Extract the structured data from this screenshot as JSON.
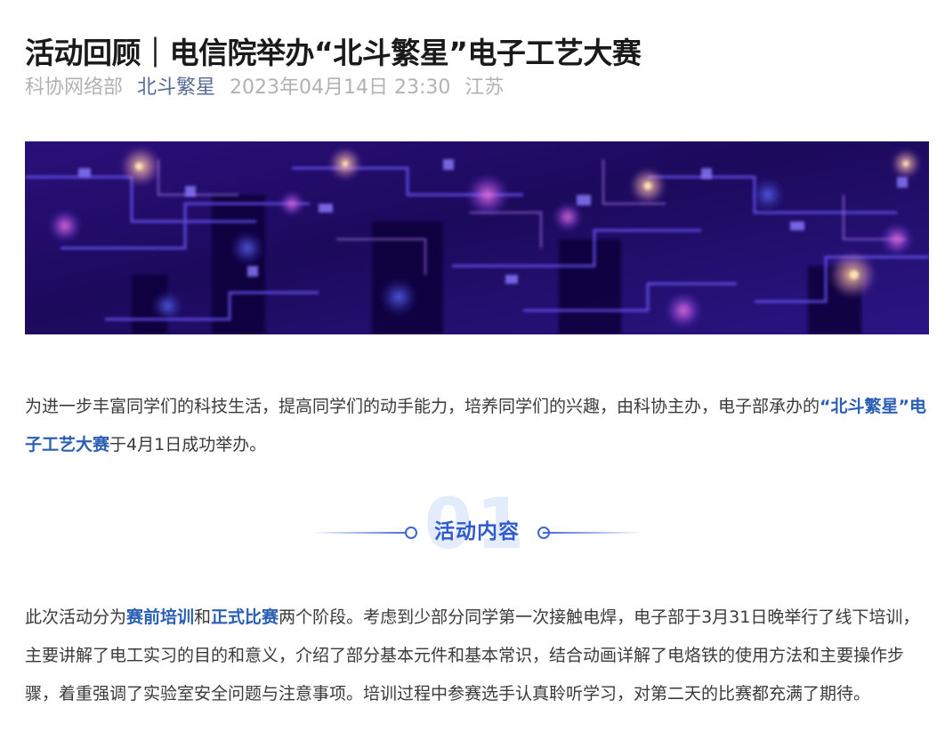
{
  "article": {
    "title": "活动回顾｜电信院举办“北斗繁星”电子工艺大赛",
    "meta": {
      "author": "科协网络部",
      "account": "北斗繁星",
      "datetime": "2023年04月14日 23:30",
      "location": "江苏"
    }
  },
  "banner": {
    "icon": "circuit-board-image"
  },
  "intro": {
    "text_1": "为进一步丰富同学们的科技生活，提高同学们的动手能力，培养同学们的兴趣，由科协主办，电子部承办的",
    "highlight": "“北斗繁星”电子工艺大赛",
    "text_2": "于4月1日成功举办。"
  },
  "section_1": {
    "number": "01",
    "title": "活动内容"
  },
  "content": {
    "text_1": "此次活动分为",
    "highlight_1": "赛前培训",
    "text_2": "和",
    "highlight_2": "正式比赛",
    "text_3": "两个阶段。考虑到少部分同学第一次接触电焊，电子部于3月31日晚举行了线下培训，主要讲解了电工实习的目的和意义，介绍了部分基本元件和基本常识，结合动画详解了电烙铁的使用方法和主要操作步骤，着重强调了实验室安全问题与注意事项。培训过程中参赛选手认真聆听学习，对第二天的比赛都充满了期待。"
  },
  "colors": {
    "accent": "#2f5bd1",
    "link": "#576b95",
    "highlight": "#2b5fb3",
    "meta_gray": "#b2b2b2"
  }
}
